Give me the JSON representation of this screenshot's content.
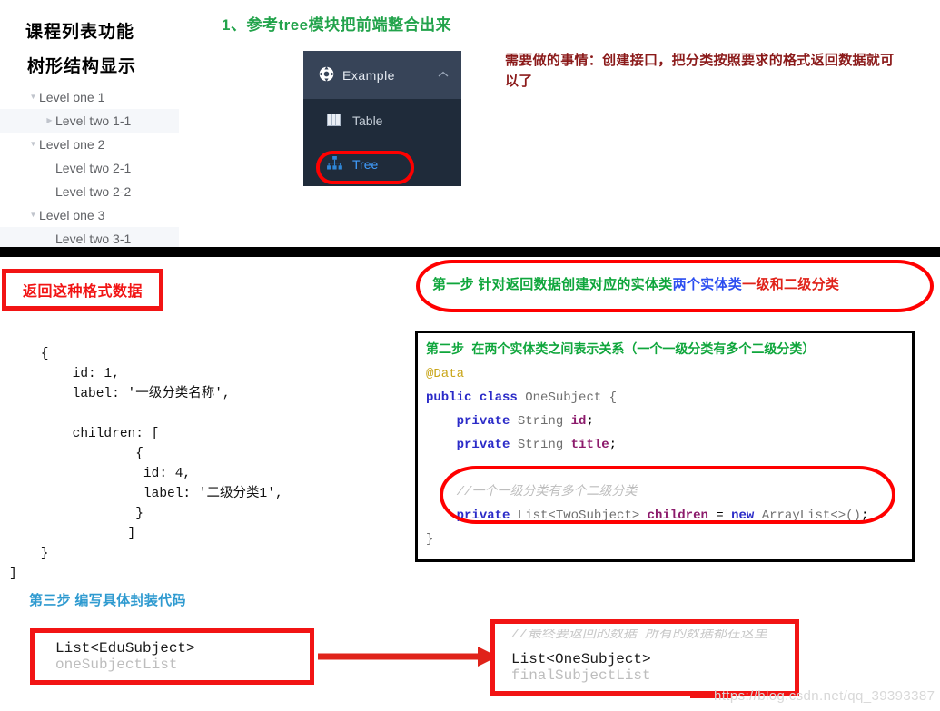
{
  "headings": {
    "course_list": "课程列表功能",
    "tree_display": "树形结构显示"
  },
  "tree": {
    "items": [
      {
        "label": "Level one 1",
        "level": 1,
        "caret": "down",
        "highlighted": false
      },
      {
        "label": "Level two 1-1",
        "level": 2,
        "caret": "right",
        "highlighted": true
      },
      {
        "label": "Level one 2",
        "level": 1,
        "caret": "down",
        "highlighted": false
      },
      {
        "label": "Level two 2-1",
        "level": 2,
        "caret": "none",
        "highlighted": false
      },
      {
        "label": "Level two 2-2",
        "level": 2,
        "caret": "none",
        "highlighted": false
      },
      {
        "label": "Level one 3",
        "level": 1,
        "caret": "down",
        "highlighted": false
      },
      {
        "label": "Level two 3-1",
        "level": 2,
        "caret": "none",
        "highlighted": true
      }
    ]
  },
  "notes": {
    "green_step1": "1、参考tree模块把前端整合出来",
    "dark_red": "需要做的事情：创建接口，把分类按照要求的格式返回数据就可以了",
    "return_format_label": "返回这种格式数据",
    "step3": "第三步 编写具体封装代码"
  },
  "menu": {
    "header_label": "Example",
    "header_icon": "compass-icon",
    "collapse_icon": "chevron-up-icon",
    "items": [
      {
        "label": "Table",
        "icon": "table-grid-icon",
        "active": false
      },
      {
        "label": "Tree",
        "icon": "sitemap-icon",
        "active": true
      }
    ]
  },
  "json_snippet": "    {\n        id: 1,\n        label: '一级分类名称',\n\n        children: [\n                {\n                 id: 4,\n                 label: '二级分类1',\n                }\n               ]\n    }\n]",
  "step1_banner": {
    "part_green": "第一步 针对返回数据创建对应的实体类",
    "part_blue": "两个实体类",
    "part_red": "一级和二级分类"
  },
  "java_code": {
    "title_line": "第二步 在两个实体类之间表示关系（一个一级分类有多个二级分类）",
    "annotation": "@Data",
    "class_kw1": "public",
    "class_kw2": "class",
    "class_name": "OneSubject",
    "brace_open": "{",
    "field1": {
      "modifier": "private",
      "type": "String",
      "name": "id",
      "semi": ";"
    },
    "field2": {
      "modifier": "private",
      "type": "String",
      "name": "title",
      "semi": ";"
    },
    "comment": "//一个一级分类有多个二级分类",
    "field3": {
      "modifier": "private",
      "type": "List<TwoSubject>",
      "name": "children",
      "eq": "=",
      "new_kw": "new",
      "ctor": "ArrayList<>()",
      "semi": ";"
    },
    "brace_close": "}"
  },
  "bottom": {
    "box_one_type": "List<EduSubject>",
    "box_one_var": "oneSubjectList",
    "box_final_comment": "//最终要返回的数据 所有的数据都在这里",
    "box_final_type": "List<OneSubject>",
    "box_final_var": "finalSubjectList"
  },
  "watermark": "https://blog.csdn.net/qq_39393387",
  "colors": {
    "red": "#f21414",
    "green": "#0fa63c",
    "blue": "#2b4df0",
    "dark_red": "#8b1a1a",
    "link_blue": "#409eff",
    "panel_dark": "#1f2b3a",
    "panel_head": "#374458"
  }
}
